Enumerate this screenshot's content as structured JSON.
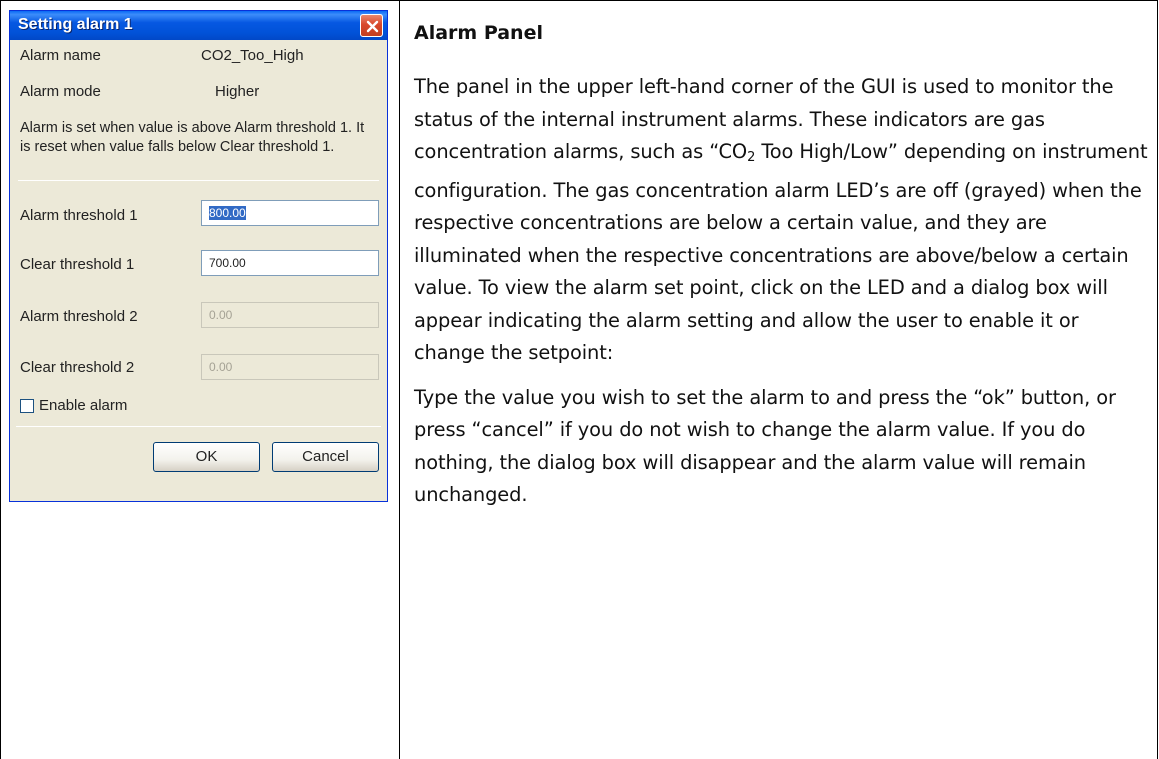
{
  "dialog": {
    "title": "Setting alarm 1",
    "alarm_name_label": "Alarm name",
    "alarm_name_value": "CO2_Too_High",
    "alarm_mode_label": "Alarm mode",
    "alarm_mode_value": "Higher",
    "description": "Alarm is set when value is above Alarm threshold 1. It is reset when value falls below Clear threshold 1.",
    "alarm_threshold_1_label": "Alarm threshold 1",
    "alarm_threshold_1_value": "800.00",
    "clear_threshold_1_label": "Clear threshold 1",
    "clear_threshold_1_value": "700.00",
    "alarm_threshold_2_label": "Alarm threshold 2",
    "alarm_threshold_2_value": "0.00",
    "clear_threshold_2_label": "Clear threshold 2",
    "clear_threshold_2_value": "0.00",
    "enable_alarm_label": "Enable alarm",
    "ok_label": "OK",
    "cancel_label": "Cancel"
  },
  "document": {
    "heading": "Alarm Panel",
    "para1_a": "The panel in the upper left-hand corner of the GUI is used to monitor the status of the internal instrument alarms.  These indicators are gas concentration alarms, such as “CO",
    "para1_sub": "2",
    "para1_b": " Too High/Low” depending on instrument configuration. The gas concentration alarm LED’s are off (grayed) when the respective concentrations are below a certain value, and they are illuminated when the respective concentrations are above/below a certain value.  To view the alarm set point, click on the LED and a dialog box will appear indicating the alarm setting and allow the user to enable it or change the setpoint:",
    "para2": "Type the value you wish to set the alarm to and press the “ok” button, or press “cancel” if you do not wish to change the alarm value.  If you do nothing, the dialog box will disappear and the alarm value will remain unchanged."
  }
}
